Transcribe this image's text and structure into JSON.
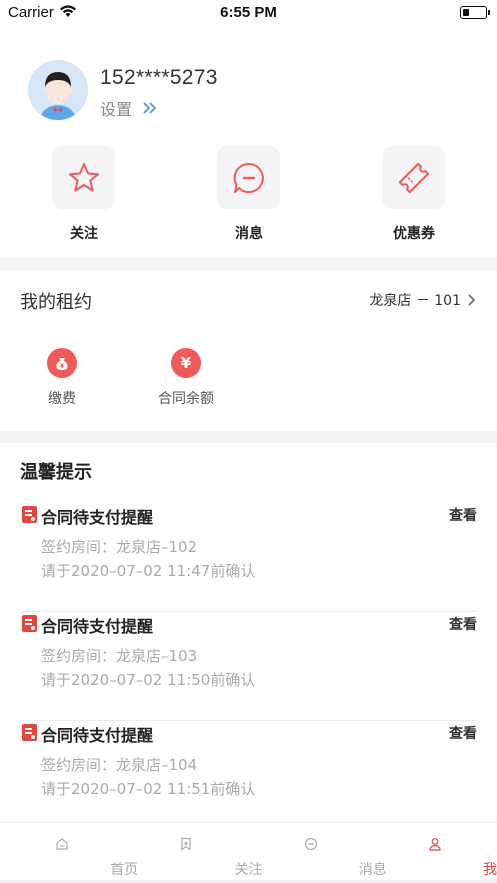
{
  "status_bar": {
    "carrier": "Carrier",
    "time": "6:55 PM",
    "battery_level": 0.3
  },
  "profile": {
    "phone": "152****5273",
    "settings_label": "设置"
  },
  "quick_actions": [
    {
      "label": "关注",
      "icon": "star-icon"
    },
    {
      "label": "消息",
      "icon": "message-icon"
    },
    {
      "label": "优惠券",
      "icon": "coupon-icon"
    }
  ],
  "rental": {
    "title": "我的租约",
    "store": "龙泉店 － 101",
    "items": [
      {
        "label": "缴费",
        "icon": "money-bag-icon"
      },
      {
        "label": "合同余额",
        "icon": "yuan-icon",
        "glyph": "¥"
      }
    ]
  },
  "reminders": {
    "title": "温馨提示",
    "items": [
      {
        "title": "合同待支付提醒",
        "view": "查看",
        "room": "签约房间：龙泉店–102",
        "deadline": "请于2020–07–02 11:47前确认"
      },
      {
        "title": "合同待支付提醒",
        "view": "查看",
        "room": "签约房间：龙泉店–103",
        "deadline": "请于2020–07–02 11:50前确认"
      },
      {
        "title": "合同待支付提醒",
        "view": "查看",
        "room": "签约房间：龙泉店–104",
        "deadline": "请于2020–07–02 11:51前确认"
      }
    ]
  },
  "tab_bar": {
    "tabs": [
      {
        "label": "首页",
        "icon": "home-icon"
      },
      {
        "label": "关注",
        "icon": "bookmark-icon"
      },
      {
        "label": "消息",
        "icon": "chat-icon"
      },
      {
        "label": "我的",
        "icon": "user-icon"
      }
    ],
    "active_index": 3
  },
  "colors": {
    "accent": "#e2473f",
    "icon_red": "#f05a5a",
    "band": "#f5f5f7",
    "avatar_bg": "#d6e6f7"
  }
}
